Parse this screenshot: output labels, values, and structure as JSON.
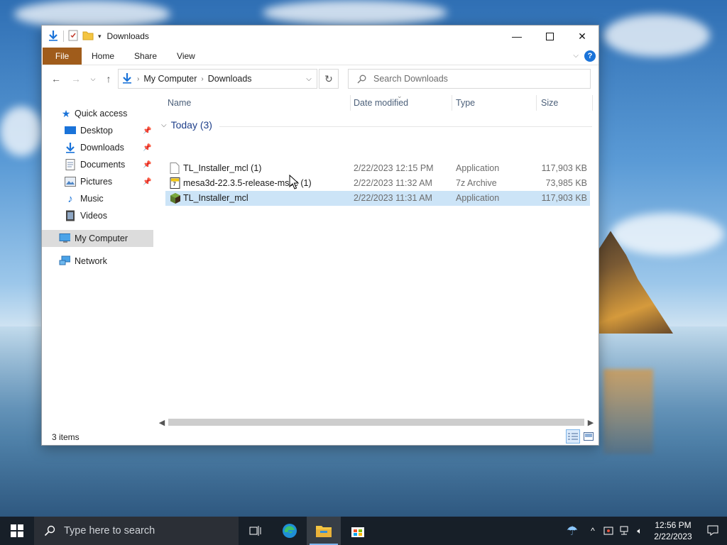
{
  "window": {
    "title": "Downloads",
    "ribbon_tabs": [
      "File",
      "Home",
      "Share",
      "View"
    ]
  },
  "navbar": {
    "breadcrumb": [
      "My Computer",
      "Downloads"
    ],
    "search_placeholder": "Search Downloads"
  },
  "sidebar": {
    "quick_access": "Quick access",
    "items": [
      {
        "label": "Desktop",
        "icon": "desktop-icon",
        "pinned": true
      },
      {
        "label": "Downloads",
        "icon": "download-icon",
        "pinned": true
      },
      {
        "label": "Documents",
        "icon": "document-icon",
        "pinned": true
      },
      {
        "label": "Pictures",
        "icon": "pictures-icon",
        "pinned": true
      },
      {
        "label": "Music",
        "icon": "music-icon",
        "pinned": false
      },
      {
        "label": "Videos",
        "icon": "videos-icon",
        "pinned": false
      }
    ],
    "my_computer": "My Computer",
    "network": "Network"
  },
  "columns": {
    "name": "Name",
    "date": "Date modified",
    "type": "Type",
    "size": "Size"
  },
  "group": {
    "label": "Today (3)"
  },
  "files": [
    {
      "name": "TL_Installer_mcl (1)",
      "date": "2/22/2023 12:15 PM",
      "type": "Application",
      "size": "117,903 KB",
      "icon": "blank-file-icon"
    },
    {
      "name": "mesa3d-22.3.5-release-msvc (1)",
      "date": "2/22/2023 11:32 AM",
      "type": "7z Archive",
      "size": "73,985 KB",
      "icon": "archive-file-icon"
    },
    {
      "name": "TL_Installer_mcl",
      "date": "2/22/2023 11:31 AM",
      "type": "Application",
      "size": "117,903 KB",
      "icon": "app-block-icon"
    }
  ],
  "status": {
    "count": "3 items"
  },
  "taskbar": {
    "search_placeholder": "Type here to search",
    "time": "12:56 PM",
    "date": "2/22/2023"
  },
  "colors": {
    "file_tab": "#a05c1b",
    "selection": "#cce4f7",
    "group_header": "#1e3f8a",
    "accent": "#1a73d9"
  }
}
